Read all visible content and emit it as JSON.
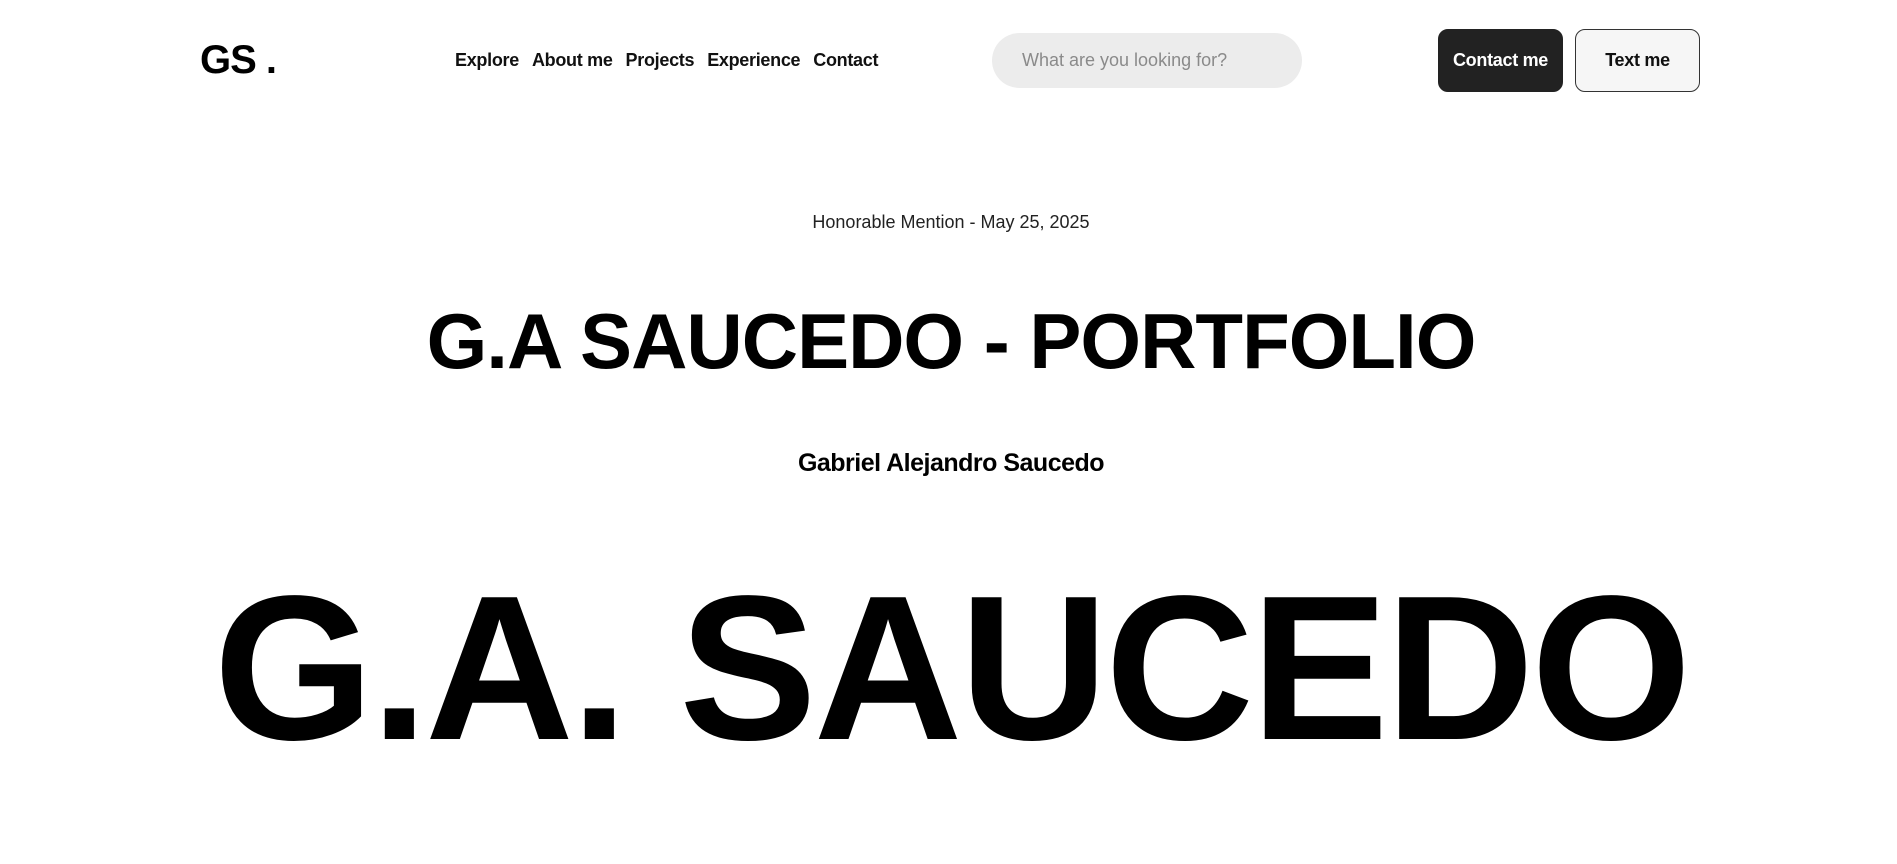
{
  "header": {
    "logo": "GS .",
    "nav": [
      "Explore",
      "About me",
      "Projects",
      "Experience",
      "Contact"
    ],
    "search_placeholder": "What are you looking for?",
    "contact_button": "Contact me",
    "text_button": "Text me"
  },
  "hero": {
    "meta": "Honorable Mention - May 25, 2025",
    "title": "G.A SAUCEDO - PORTFOLIO",
    "subtitle": "Gabriel Alejandro Saucedo",
    "giant": "G.A. SAUCEDO"
  },
  "colors": {
    "dark_button": "#222222",
    "search_bg": "#ececec"
  }
}
